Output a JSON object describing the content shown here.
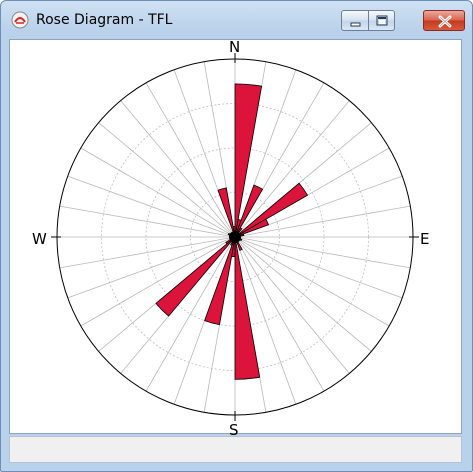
{
  "window": {
    "title": "Rose Diagram - TFL",
    "icon": "rose-diagram-app-icon",
    "controls": [
      "minimize-icon",
      "maximize-icon",
      "close-icon"
    ]
  },
  "compass": {
    "north": "N",
    "east": "E",
    "south": "S",
    "west": "W"
  },
  "chart_data": {
    "type": "rose",
    "title": "",
    "bin_width_degrees": 10,
    "radial_max": 1.0,
    "rings": 4,
    "spoke_step_degrees": 10,
    "fill_color": "#dc143c",
    "edge_color": "#000000",
    "bins": [
      {
        "from": 0,
        "to": 10,
        "value": 0.86
      },
      {
        "from": 10,
        "to": 20,
        "value": 0.1
      },
      {
        "from": 20,
        "to": 30,
        "value": 0.31
      },
      {
        "from": 30,
        "to": 40,
        "value": 0.06
      },
      {
        "from": 50,
        "to": 60,
        "value": 0.47
      },
      {
        "from": 60,
        "to": 70,
        "value": 0.2
      },
      {
        "from": 70,
        "to": 80,
        "value": 0.05
      },
      {
        "from": 80,
        "to": 90,
        "value": 0.03
      },
      {
        "from": 110,
        "to": 120,
        "value": 0.04
      },
      {
        "from": 150,
        "to": 160,
        "value": 0.08
      },
      {
        "from": 170,
        "to": 180,
        "value": 0.8
      },
      {
        "from": 180,
        "to": 190,
        "value": 0.11
      },
      {
        "from": 190,
        "to": 200,
        "value": 0.5
      },
      {
        "from": 200,
        "to": 210,
        "value": 0.05
      },
      {
        "from": 220,
        "to": 230,
        "value": 0.58
      },
      {
        "from": 230,
        "to": 240,
        "value": 0.06
      },
      {
        "from": 270,
        "to": 280,
        "value": 0.03
      },
      {
        "from": 290,
        "to": 300,
        "value": 0.04
      },
      {
        "from": 340,
        "to": 350,
        "value": 0.28
      },
      {
        "from": 350,
        "to": 360,
        "value": 0.06
      }
    ]
  }
}
